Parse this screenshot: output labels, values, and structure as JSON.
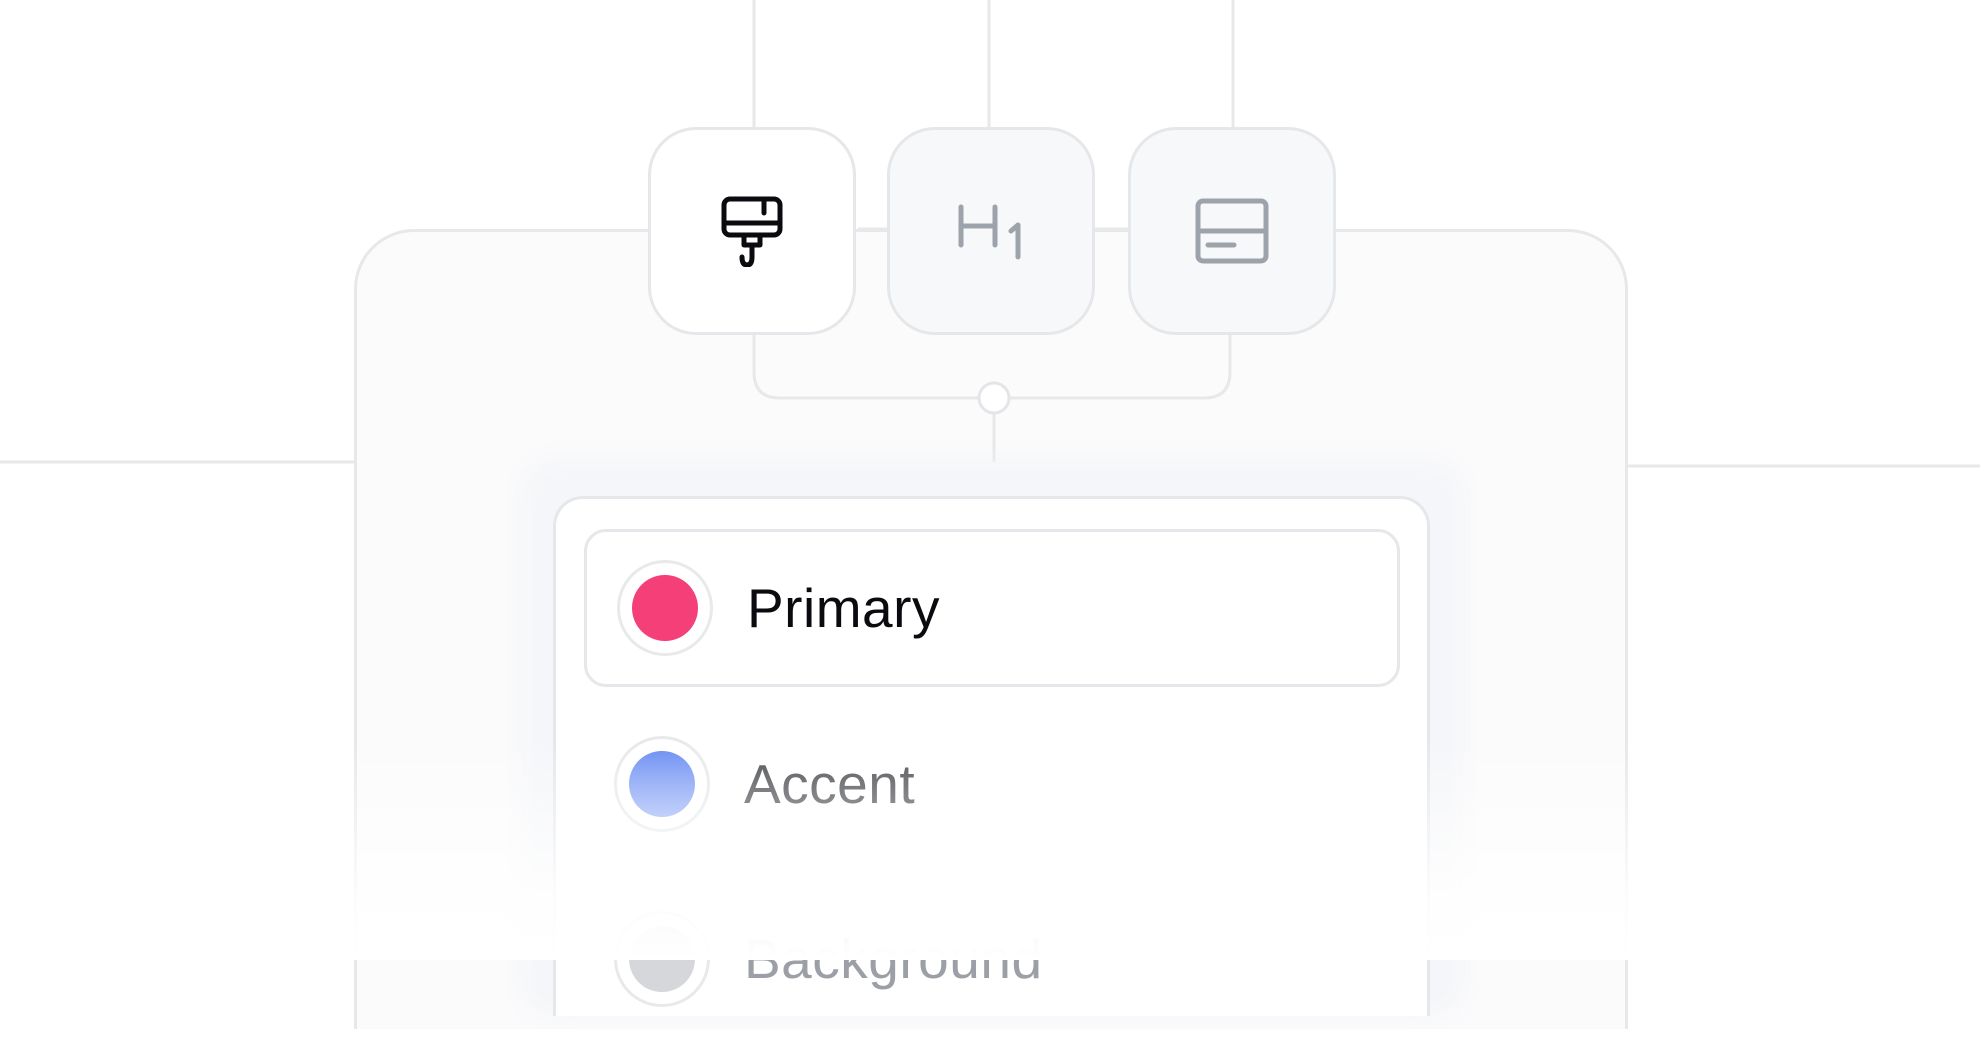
{
  "toolbar": {
    "tools": [
      {
        "name": "paint-brush",
        "icon": "paint-brush-icon",
        "active": true
      },
      {
        "name": "heading-1",
        "icon": "heading-1-icon",
        "active": false
      },
      {
        "name": "layout",
        "icon": "layout-icon",
        "active": false
      }
    ]
  },
  "colors": {
    "options": [
      {
        "label": "Primary",
        "color": "#f43f78",
        "selected": true,
        "text_color": "#0b0b0f"
      },
      {
        "label": "Accent",
        "color": "#7b9cf4",
        "selected": false,
        "text_color": "#4b4d52"
      },
      {
        "label": "Background",
        "color": "#d6d7da",
        "selected": false,
        "text_color": "#9ca0a6"
      }
    ]
  },
  "theme": {
    "border": "#e5e7eb",
    "icon_active": "#0b0b0f",
    "icon_inactive": "#9ca3ab"
  }
}
